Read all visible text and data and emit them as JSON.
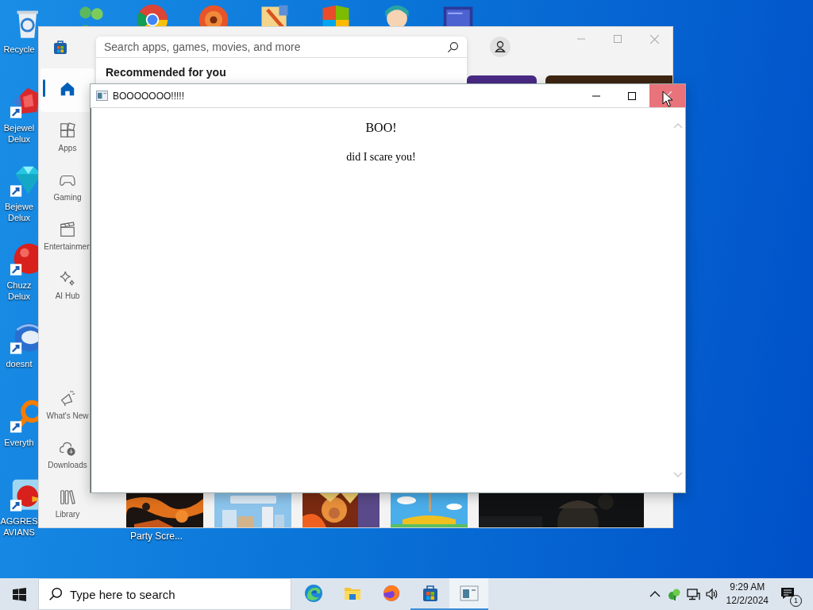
{
  "desktop": {
    "top_icons": [
      {
        "kind": "people"
      },
      {
        "kind": "ring"
      },
      {
        "kind": "disc"
      },
      {
        "kind": "folder"
      },
      {
        "kind": "tiles"
      },
      {
        "kind": "figure"
      },
      {
        "kind": "screen"
      }
    ],
    "left_icons": [
      {
        "kind": "bin",
        "shortcut": false,
        "lines": [
          "Recycle"
        ]
      },
      {
        "kind": "jewel",
        "shortcut": true,
        "lines": [
          "Bejewel",
          "Delux"
        ]
      },
      {
        "kind": "gem",
        "shortcut": true,
        "lines": [
          "Bejewe",
          "Delux"
        ]
      },
      {
        "kind": "ball",
        "shortcut": true,
        "lines": [
          "Chuzz",
          "Delux"
        ]
      },
      {
        "kind": "globe",
        "shortcut": true,
        "lines": [
          "doesnt"
        ]
      },
      {
        "kind": "magnifier",
        "shortcut": true,
        "lines": [
          "Everyth"
        ]
      },
      {
        "kind": "bird",
        "shortcut": true,
        "lines": [
          "AGGRES",
          "AVIANS"
        ]
      }
    ],
    "covered_icon_label": "Party Scre..."
  },
  "store": {
    "search": {
      "placeholder": "Search apps, games, movies, and more"
    },
    "suggest_heading": "Recommended for you",
    "sidebar": [
      {
        "kind": "home",
        "selected": true
      },
      {
        "kind": "apps",
        "label": "Apps",
        "selected": false
      },
      {
        "kind": "gaming",
        "label": "Gaming",
        "selected": false
      },
      {
        "kind": "film",
        "label": "Entertainmen",
        "selected": false
      },
      {
        "kind": "sparkle",
        "label": "AI Hub",
        "selected": false
      }
    ],
    "sidebar_bottom": [
      {
        "kind": "megaphone",
        "label": "What's New",
        "selected": false
      },
      {
        "kind": "cloud",
        "label": "Downloads",
        "selected": false
      },
      {
        "kind": "library",
        "label": "Library",
        "selected": false
      }
    ]
  },
  "dialog": {
    "title": "BOOOOOOO!!!!!",
    "close_hovered": true,
    "heading": "BOO!",
    "message": "did I scare you!"
  },
  "taskbar": {
    "search_placeholder": "Type here to search",
    "apps": [
      {
        "kind": "wave",
        "running": false,
        "selected": false
      },
      {
        "kind": "folder",
        "running": false,
        "selected": false
      },
      {
        "kind": "fox",
        "running": false,
        "selected": false
      },
      {
        "kind": "bag",
        "running": true,
        "selected": false
      },
      {
        "kind": "window",
        "running": true,
        "selected": true
      }
    ],
    "tray": [
      {
        "kind": "caret"
      },
      {
        "kind": "leaf"
      },
      {
        "kind": "network"
      },
      {
        "kind": "volume"
      }
    ],
    "time": "9:29 AM",
    "date": "12/2/2024",
    "notifications": "1"
  }
}
